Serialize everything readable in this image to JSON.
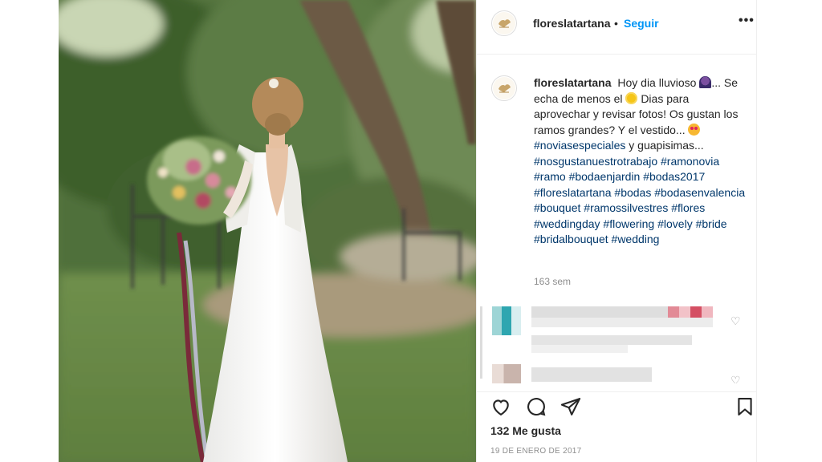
{
  "post": {
    "username": "floreslatartana",
    "separator": "•",
    "follow_label": "Seguir",
    "more_label": "•••",
    "caption": {
      "username": "floreslatartana",
      "text_1": "Hoy dia lluvioso",
      "text_2": "Se echa de menos el",
      "text_3": "Dias para aprovechar y revisar fotos! Os gustan los ramos grandes? Y el vestido...",
      "text_4": "#noviasespeciales",
      "text_5": "y guapisimas...",
      "hashtags": [
        "#nosgustanuestrotrabajo",
        "#ramonovia",
        "#ramo",
        "#bodaenjardin",
        "#bodas2017",
        "#floreslatartana",
        "#bodas",
        "#bodasenvalencia",
        "#bouquet",
        "#ramossilvestres",
        "#flores",
        "#weddingday",
        "#flowering",
        "#lovely",
        "#bride",
        "#bridalbouquet",
        "#wedding"
      ]
    },
    "time_ago": "163 sem",
    "likes": "132 Me gusta",
    "date": "19 DE ENERO DE 2017"
  },
  "icons": {
    "like": "heart-icon",
    "comment": "comment-icon",
    "share": "paper-plane-icon",
    "save": "bookmark-icon",
    "more": "ellipsis-icon"
  },
  "colors": {
    "link_blue": "#0095f6",
    "hashtag": "#00376b",
    "text": "#262626",
    "muted": "#8e8e8e"
  }
}
